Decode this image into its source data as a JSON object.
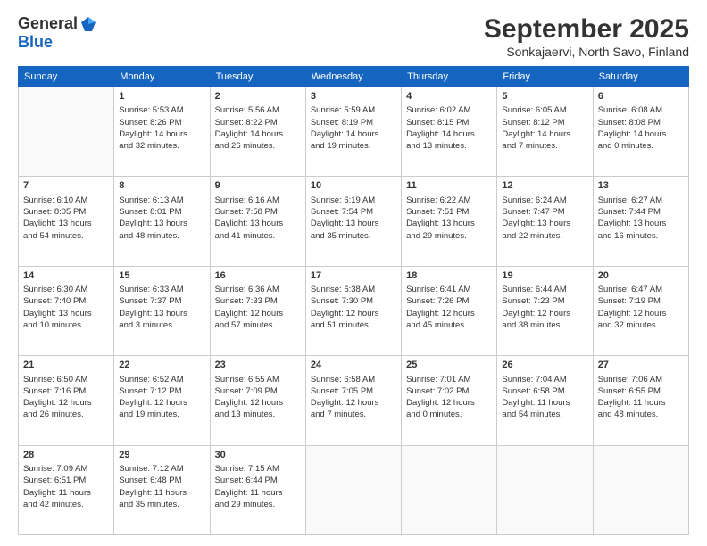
{
  "logo": {
    "general": "General",
    "blue": "Blue"
  },
  "title": "September 2025",
  "location": "Sonkajaervi, North Savo, Finland",
  "weekdays": [
    "Sunday",
    "Monday",
    "Tuesday",
    "Wednesday",
    "Thursday",
    "Friday",
    "Saturday"
  ],
  "weeks": [
    [
      {
        "day": "",
        "content": ""
      },
      {
        "day": "1",
        "content": "Sunrise: 5:53 AM\nSunset: 8:26 PM\nDaylight: 14 hours\nand 32 minutes."
      },
      {
        "day": "2",
        "content": "Sunrise: 5:56 AM\nSunset: 8:22 PM\nDaylight: 14 hours\nand 26 minutes."
      },
      {
        "day": "3",
        "content": "Sunrise: 5:59 AM\nSunset: 8:19 PM\nDaylight: 14 hours\nand 19 minutes."
      },
      {
        "day": "4",
        "content": "Sunrise: 6:02 AM\nSunset: 8:15 PM\nDaylight: 14 hours\nand 13 minutes."
      },
      {
        "day": "5",
        "content": "Sunrise: 6:05 AM\nSunset: 8:12 PM\nDaylight: 14 hours\nand 7 minutes."
      },
      {
        "day": "6",
        "content": "Sunrise: 6:08 AM\nSunset: 8:08 PM\nDaylight: 14 hours\nand 0 minutes."
      }
    ],
    [
      {
        "day": "7",
        "content": "Sunrise: 6:10 AM\nSunset: 8:05 PM\nDaylight: 13 hours\nand 54 minutes."
      },
      {
        "day": "8",
        "content": "Sunrise: 6:13 AM\nSunset: 8:01 PM\nDaylight: 13 hours\nand 48 minutes."
      },
      {
        "day": "9",
        "content": "Sunrise: 6:16 AM\nSunset: 7:58 PM\nDaylight: 13 hours\nand 41 minutes."
      },
      {
        "day": "10",
        "content": "Sunrise: 6:19 AM\nSunset: 7:54 PM\nDaylight: 13 hours\nand 35 minutes."
      },
      {
        "day": "11",
        "content": "Sunrise: 6:22 AM\nSunset: 7:51 PM\nDaylight: 13 hours\nand 29 minutes."
      },
      {
        "day": "12",
        "content": "Sunrise: 6:24 AM\nSunset: 7:47 PM\nDaylight: 13 hours\nand 22 minutes."
      },
      {
        "day": "13",
        "content": "Sunrise: 6:27 AM\nSunset: 7:44 PM\nDaylight: 13 hours\nand 16 minutes."
      }
    ],
    [
      {
        "day": "14",
        "content": "Sunrise: 6:30 AM\nSunset: 7:40 PM\nDaylight: 13 hours\nand 10 minutes."
      },
      {
        "day": "15",
        "content": "Sunrise: 6:33 AM\nSunset: 7:37 PM\nDaylight: 13 hours\nand 3 minutes."
      },
      {
        "day": "16",
        "content": "Sunrise: 6:36 AM\nSunset: 7:33 PM\nDaylight: 12 hours\nand 57 minutes."
      },
      {
        "day": "17",
        "content": "Sunrise: 6:38 AM\nSunset: 7:30 PM\nDaylight: 12 hours\nand 51 minutes."
      },
      {
        "day": "18",
        "content": "Sunrise: 6:41 AM\nSunset: 7:26 PM\nDaylight: 12 hours\nand 45 minutes."
      },
      {
        "day": "19",
        "content": "Sunrise: 6:44 AM\nSunset: 7:23 PM\nDaylight: 12 hours\nand 38 minutes."
      },
      {
        "day": "20",
        "content": "Sunrise: 6:47 AM\nSunset: 7:19 PM\nDaylight: 12 hours\nand 32 minutes."
      }
    ],
    [
      {
        "day": "21",
        "content": "Sunrise: 6:50 AM\nSunset: 7:16 PM\nDaylight: 12 hours\nand 26 minutes."
      },
      {
        "day": "22",
        "content": "Sunrise: 6:52 AM\nSunset: 7:12 PM\nDaylight: 12 hours\nand 19 minutes."
      },
      {
        "day": "23",
        "content": "Sunrise: 6:55 AM\nSunset: 7:09 PM\nDaylight: 12 hours\nand 13 minutes."
      },
      {
        "day": "24",
        "content": "Sunrise: 6:58 AM\nSunset: 7:05 PM\nDaylight: 12 hours\nand 7 minutes."
      },
      {
        "day": "25",
        "content": "Sunrise: 7:01 AM\nSunset: 7:02 PM\nDaylight: 12 hours\nand 0 minutes."
      },
      {
        "day": "26",
        "content": "Sunrise: 7:04 AM\nSunset: 6:58 PM\nDaylight: 11 hours\nand 54 minutes."
      },
      {
        "day": "27",
        "content": "Sunrise: 7:06 AM\nSunset: 6:55 PM\nDaylight: 11 hours\nand 48 minutes."
      }
    ],
    [
      {
        "day": "28",
        "content": "Sunrise: 7:09 AM\nSunset: 6:51 PM\nDaylight: 11 hours\nand 42 minutes."
      },
      {
        "day": "29",
        "content": "Sunrise: 7:12 AM\nSunset: 6:48 PM\nDaylight: 11 hours\nand 35 minutes."
      },
      {
        "day": "30",
        "content": "Sunrise: 7:15 AM\nSunset: 6:44 PM\nDaylight: 11 hours\nand 29 minutes."
      },
      {
        "day": "",
        "content": ""
      },
      {
        "day": "",
        "content": ""
      },
      {
        "day": "",
        "content": ""
      },
      {
        "day": "",
        "content": ""
      }
    ]
  ]
}
